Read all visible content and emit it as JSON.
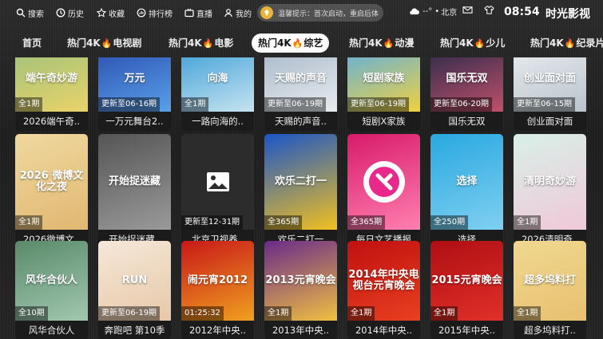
{
  "topbar": {
    "nav": [
      {
        "label": "搜索",
        "icon": "search-icon"
      },
      {
        "label": "历史",
        "icon": "history-icon"
      },
      {
        "label": "收藏",
        "icon": "star-icon"
      },
      {
        "label": "排行榜",
        "icon": "ranking-icon"
      },
      {
        "label": "直播",
        "icon": "tv-icon"
      },
      {
        "label": "我的",
        "icon": "user-icon"
      }
    ],
    "notice": "温馨提示：首次启动，重启后体",
    "signal": "--°",
    "city": "北京",
    "time": "08:54",
    "brand": "时光影视"
  },
  "tabs": [
    {
      "label": "首页",
      "hot": false
    },
    {
      "label": "热门4K",
      "suffix": "电视剧",
      "hot": true
    },
    {
      "label": "热门4K",
      "suffix": "电影",
      "hot": true
    },
    {
      "label": "热门4K",
      "suffix": "综艺",
      "hot": true,
      "active": true
    },
    {
      "label": "热门4K",
      "suffix": "动漫",
      "hot": true
    },
    {
      "label": "热门4K",
      "suffix": "少儿",
      "hot": true
    },
    {
      "label": "热门4K",
      "suffix": "纪录片",
      "hot": true
    }
  ],
  "rows": [
    [
      {
        "badge": "全1期",
        "title": "2026端午奇..",
        "poster": "端午奇妙游",
        "c1": "#9fc27a",
        "c2": "#e9d36a"
      },
      {
        "badge": "更新至06-16期",
        "title": "一万元舞台2..",
        "poster": "万元",
        "c1": "#2a4fb0",
        "c2": "#5aa0e8"
      },
      {
        "badge": "全1期",
        "title": "一路向海的..",
        "poster": "向海",
        "c1": "#3ea0d8",
        "c2": "#c6e3f0"
      },
      {
        "badge": "更新至06-19期",
        "title": "天赐的声音..",
        "poster": "天赐的声音",
        "c1": "#a8b8c8",
        "c2": "#e8ecf0"
      },
      {
        "badge": "更新至06-19期",
        "title": "短剧X家族",
        "poster": "短剧家族",
        "c1": "#5fb0e0",
        "c2": "#f0d040"
      },
      {
        "badge": "更新至06-20期",
        "title": "国乐无双",
        "poster": "国乐无双",
        "c1": "#2a2a4a",
        "c2": "#c0506a"
      },
      {
        "badge": "更新至06-15期",
        "title": "创业面对面",
        "poster": "创业面对面",
        "c1": "#e8ecef",
        "c2": "#b8c4cc"
      }
    ],
    [
      {
        "badge": "全1期",
        "title": "2026微博文..",
        "poster": "2026 微博文化之夜",
        "c1": "#f0d8a0",
        "c2": "#e0b870"
      },
      {
        "badge": "",
        "title": "开始捉迷藏..",
        "poster": "开始捉迷藏",
        "c1": "#555555",
        "c2": "#9a9a9a"
      },
      {
        "badge": "更新至12-31期",
        "title": "北京卫视养..",
        "poster": "",
        "c1": "#2c2c2c",
        "c2": "#2c2c2c"
      },
      {
        "badge": "全365期",
        "title": "欢乐二打一",
        "poster": "欢乐二打一",
        "c1": "#1a55c8",
        "c2": "#f2c020"
      },
      {
        "badge": "全365期",
        "title": "每日文艺播报",
        "poster": "",
        "c1": "#d81a6a",
        "c2": "#ff80b0"
      },
      {
        "badge": "全250期",
        "title": "选择",
        "poster": "选择",
        "c1": "#29a8e0",
        "c2": "#7fd0f0"
      },
      {
        "badge": "全1期",
        "title": "2026清明奇..",
        "poster": "清明奇妙游",
        "c1": "#d8f0e8",
        "c2": "#f0c8d8"
      }
    ],
    [
      {
        "badge": "全10期",
        "title": "风华合伙人",
        "poster": "风华合伙人",
        "c1": "#5a8a6a",
        "c2": "#a0c8b0"
      },
      {
        "badge": "更新至06-19期",
        "title": "奔跑吧 第10季",
        "poster": "RUN",
        "c1": "#f4e8d8",
        "c2": "#e8c8a8"
      },
      {
        "badge": "01:25:32",
        "title": "2012年中央..",
        "poster": "闹元宵2012",
        "c1": "#c81818",
        "c2": "#f0a020"
      },
      {
        "badge": "全1期",
        "title": "2013年中央..",
        "poster": "2013元宵晚会",
        "c1": "#6a2a8a",
        "c2": "#f0c040"
      },
      {
        "badge": "全1期",
        "title": "2014年中央..",
        "poster": "2014年中央电视台元宵晚会",
        "c1": "#c01010",
        "c2": "#e84020"
      },
      {
        "badge": "全1期",
        "title": "2015年中央..",
        "poster": "2015元宵晚会",
        "c1": "#b00e14",
        "c2": "#e03028"
      },
      {
        "badge": "全1期",
        "title": "超多坞料打..",
        "poster": "超多坞料打",
        "c1": "#f0d890",
        "c2": "#e8c070"
      }
    ]
  ]
}
